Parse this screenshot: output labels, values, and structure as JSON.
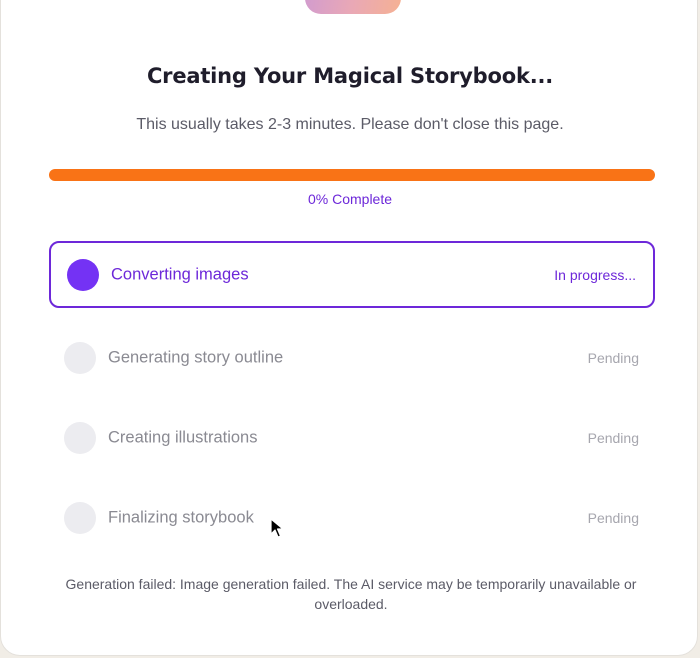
{
  "header": {
    "title": "Creating Your Magical Storybook...",
    "subtitle": "This usually takes 2-3 minutes. Please don't close this page."
  },
  "progress": {
    "percent": 0,
    "label": "0% Complete",
    "bar_color": "#f97316"
  },
  "steps": [
    {
      "label": "Converting images",
      "status": "In progress...",
      "state": "active"
    },
    {
      "label": "Generating story outline",
      "status": "Pending",
      "state": "pending"
    },
    {
      "label": "Creating illustrations",
      "status": "Pending",
      "state": "pending"
    },
    {
      "label": "Finalizing storybook",
      "status": "Pending",
      "state": "pending"
    }
  ],
  "error": {
    "message": "Generation failed: Image generation failed. The AI service may be temporarily unavailable or overloaded."
  },
  "colors": {
    "accent": "#6d28d9",
    "active_dot": "#7432f4",
    "pending_dot": "#ececf0",
    "progress": "#f97316"
  },
  "icons": {
    "logo": "storybook-logo",
    "cursor": "mouse-pointer-icon"
  }
}
